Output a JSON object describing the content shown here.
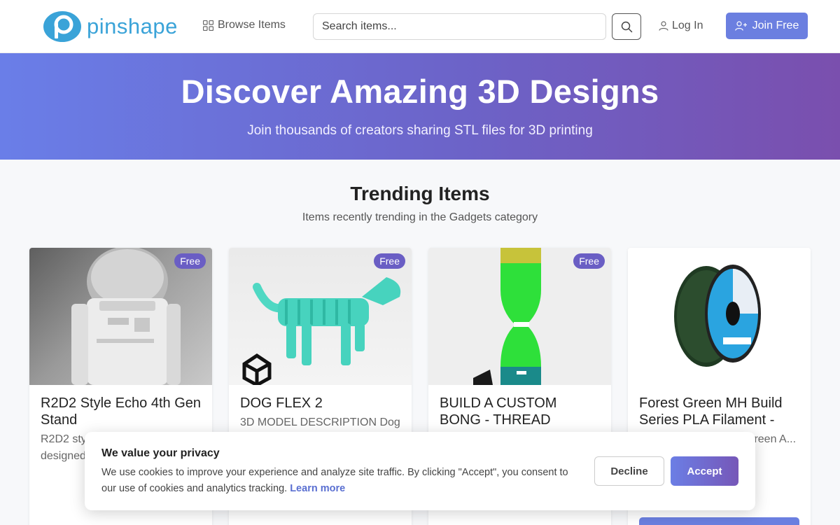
{
  "header": {
    "logo_text": "pinshape",
    "browse_label": "Browse Items",
    "search_placeholder": "Search items...",
    "login_label": "Log In",
    "join_label": "Join Free",
    "accent_color": "#6b7fe0",
    "logo_color": "#3aa3d8"
  },
  "hero": {
    "title": "Discover Amazing 3D Designs",
    "subtitle": "Join thousands of creators sharing STL files for 3D printing"
  },
  "trending": {
    "title": "Trending Items",
    "subtitle": "Items recently trending in the Gadgets category"
  },
  "cards": [
    {
      "badge": "Free",
      "title": "R2D2 Style Echo 4th Gen Stand",
      "desc": "R2D2 style Echo 4th Gen stand, designed to make it p..."
    },
    {
      "badge": "Free",
      "title": "DOG FLEX 2",
      "desc": "3D MODEL DESCRIPTION Dog"
    },
    {
      "badge": "Free",
      "title": "BUILD A CUSTOM BONG - THREAD",
      "desc": ""
    },
    {
      "badge": "",
      "title": "Forest Green MH Build Series PLA Filament -",
      "desc": "Green A..."
    }
  ],
  "cookie": {
    "title": "We value your privacy",
    "text": "We use cookies to improve your experience and analyze site traffic. By clicking \"Accept\", you consent to our use of cookies and analytics tracking.",
    "link": "Learn more",
    "decline": "Decline",
    "accept": "Accept"
  }
}
